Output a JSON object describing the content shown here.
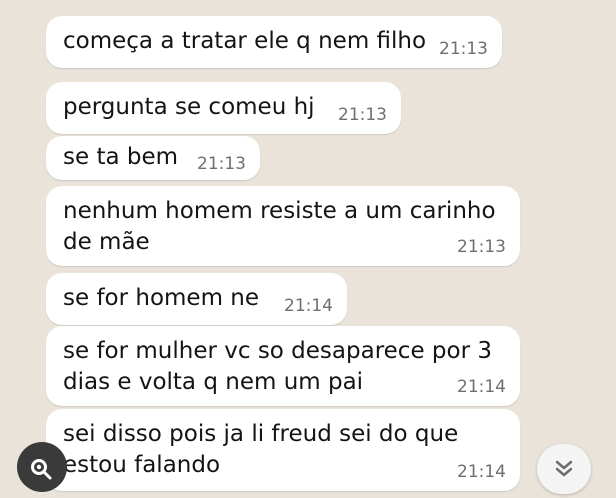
{
  "messages": [
    {
      "text": "começa a tratar ele q nem filho",
      "time": "21:13"
    },
    {
      "text": "pergunta se comeu hj",
      "time": "21:13"
    },
    {
      "text": "se ta bem",
      "time": "21:13"
    },
    {
      "text": "nenhum homem resiste a um carinho\nde mãe",
      "time": "21:13"
    },
    {
      "text": "se for homem ne",
      "time": "21:14"
    },
    {
      "text": "se for mulher vc so desaparece por 3\ndias e volta q nem um pai",
      "time": "21:14"
    },
    {
      "text": "sei disso pois ja li freud sei do que\nestou falando",
      "time": "21:14"
    }
  ],
  "icons": {
    "media": "image-search-icon",
    "scroll": "chevron-double-down-icon"
  },
  "colors": {
    "background": "#e9e3da",
    "bubble": "#ffffff",
    "time": "#6f6f6f"
  }
}
